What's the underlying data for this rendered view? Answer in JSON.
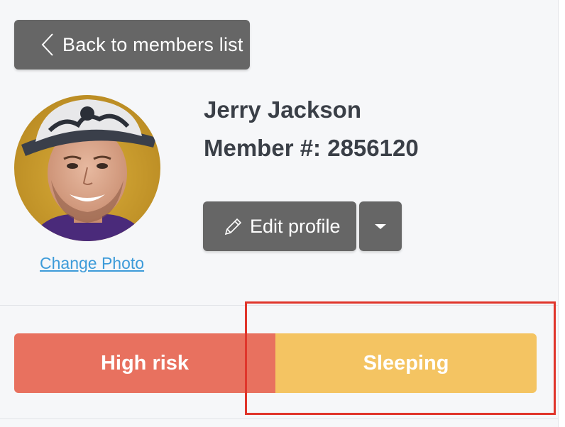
{
  "back_button": {
    "label": "Back to members list",
    "icon": "chevron-left-icon"
  },
  "member": {
    "name": "Jerry Jackson",
    "number_line": "Member #: 2856120"
  },
  "avatar": {
    "change_photo_label": "Change Photo"
  },
  "actions": {
    "edit_label": "Edit profile",
    "edit_icon": "pencil-icon",
    "dropdown_icon": "caret-down-icon"
  },
  "status": {
    "segments": [
      {
        "label": "High risk",
        "color": "#e8715f"
      },
      {
        "label": "Sleeping",
        "color": "#f4c462"
      }
    ]
  },
  "colors": {
    "button_bg": "#666666",
    "link": "#3d9bd9",
    "highlight": "#e0352b",
    "text_dark": "#3a3f47"
  }
}
